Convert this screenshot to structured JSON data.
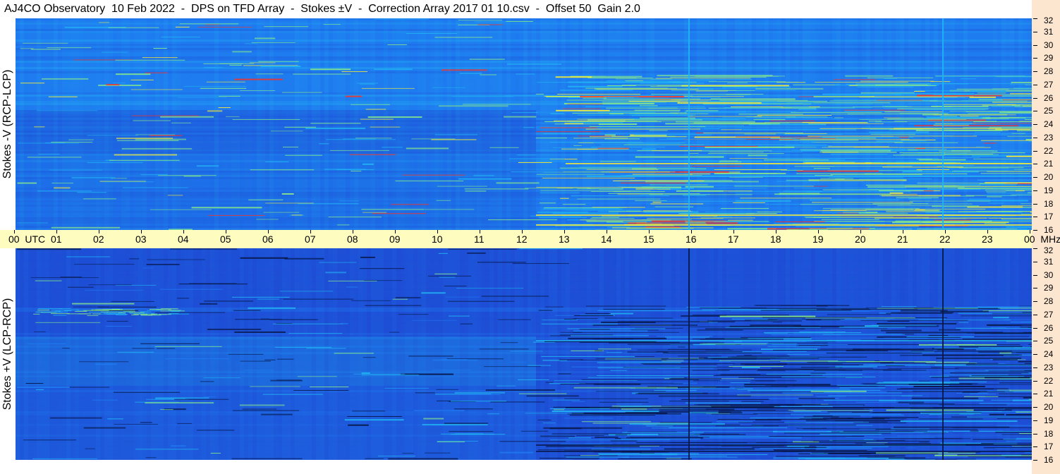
{
  "title": "AJ4CO Observatory  10 Feb 2022  -  DPS on TFD Array  -  Stokes ±V  -  Correction Array 2017 01 10.csv  -  Offset 50  Gain 2.0",
  "chart_data": [
    {
      "type": "heatmap",
      "ylabel": "Stokes -V (RCP-LCP)",
      "y_range_mhz": [
        16,
        32
      ],
      "x_range_utc_hours": [
        0,
        24
      ],
      "colors": [
        "#1e4fd6",
        "#1f7cf0",
        "#21b4f3",
        "#86e88a",
        "#f4ea3a",
        "#ff3020"
      ],
      "notable_vertical_lines_utc": [
        15.9,
        21.9
      ]
    },
    {
      "type": "heatmap",
      "ylabel": "Stokes +V (LCP-RCP)",
      "y_range_mhz": [
        16,
        32
      ],
      "x_range_utc_hours": [
        0,
        24
      ],
      "colors": [
        "#08184a",
        "#1e4fd6",
        "#1f7cf0",
        "#21b4f3",
        "#86e88a",
        "#f4ea3a"
      ],
      "notable_vertical_lines_utc": [
        15.9,
        21.9
      ]
    }
  ],
  "time_axis": {
    "labels": [
      "00  UTC",
      "01",
      "02",
      "03",
      "04",
      "05",
      "06",
      "07",
      "08",
      "09",
      "10",
      "11",
      "12",
      "13",
      "14",
      "15",
      "16",
      "17",
      "18",
      "19",
      "20",
      "21",
      "22",
      "23",
      "00  MHz"
    ]
  },
  "freq_axis": {
    "labels": [
      "32",
      "31",
      "30",
      "29",
      "28",
      "27",
      "26",
      "25",
      "24",
      "23",
      "22",
      "21",
      "20",
      "19",
      "18",
      "17",
      "16"
    ]
  },
  "colors": {
    "axis_bar": "#fffcc0",
    "right_strip": "#fde6cf"
  }
}
